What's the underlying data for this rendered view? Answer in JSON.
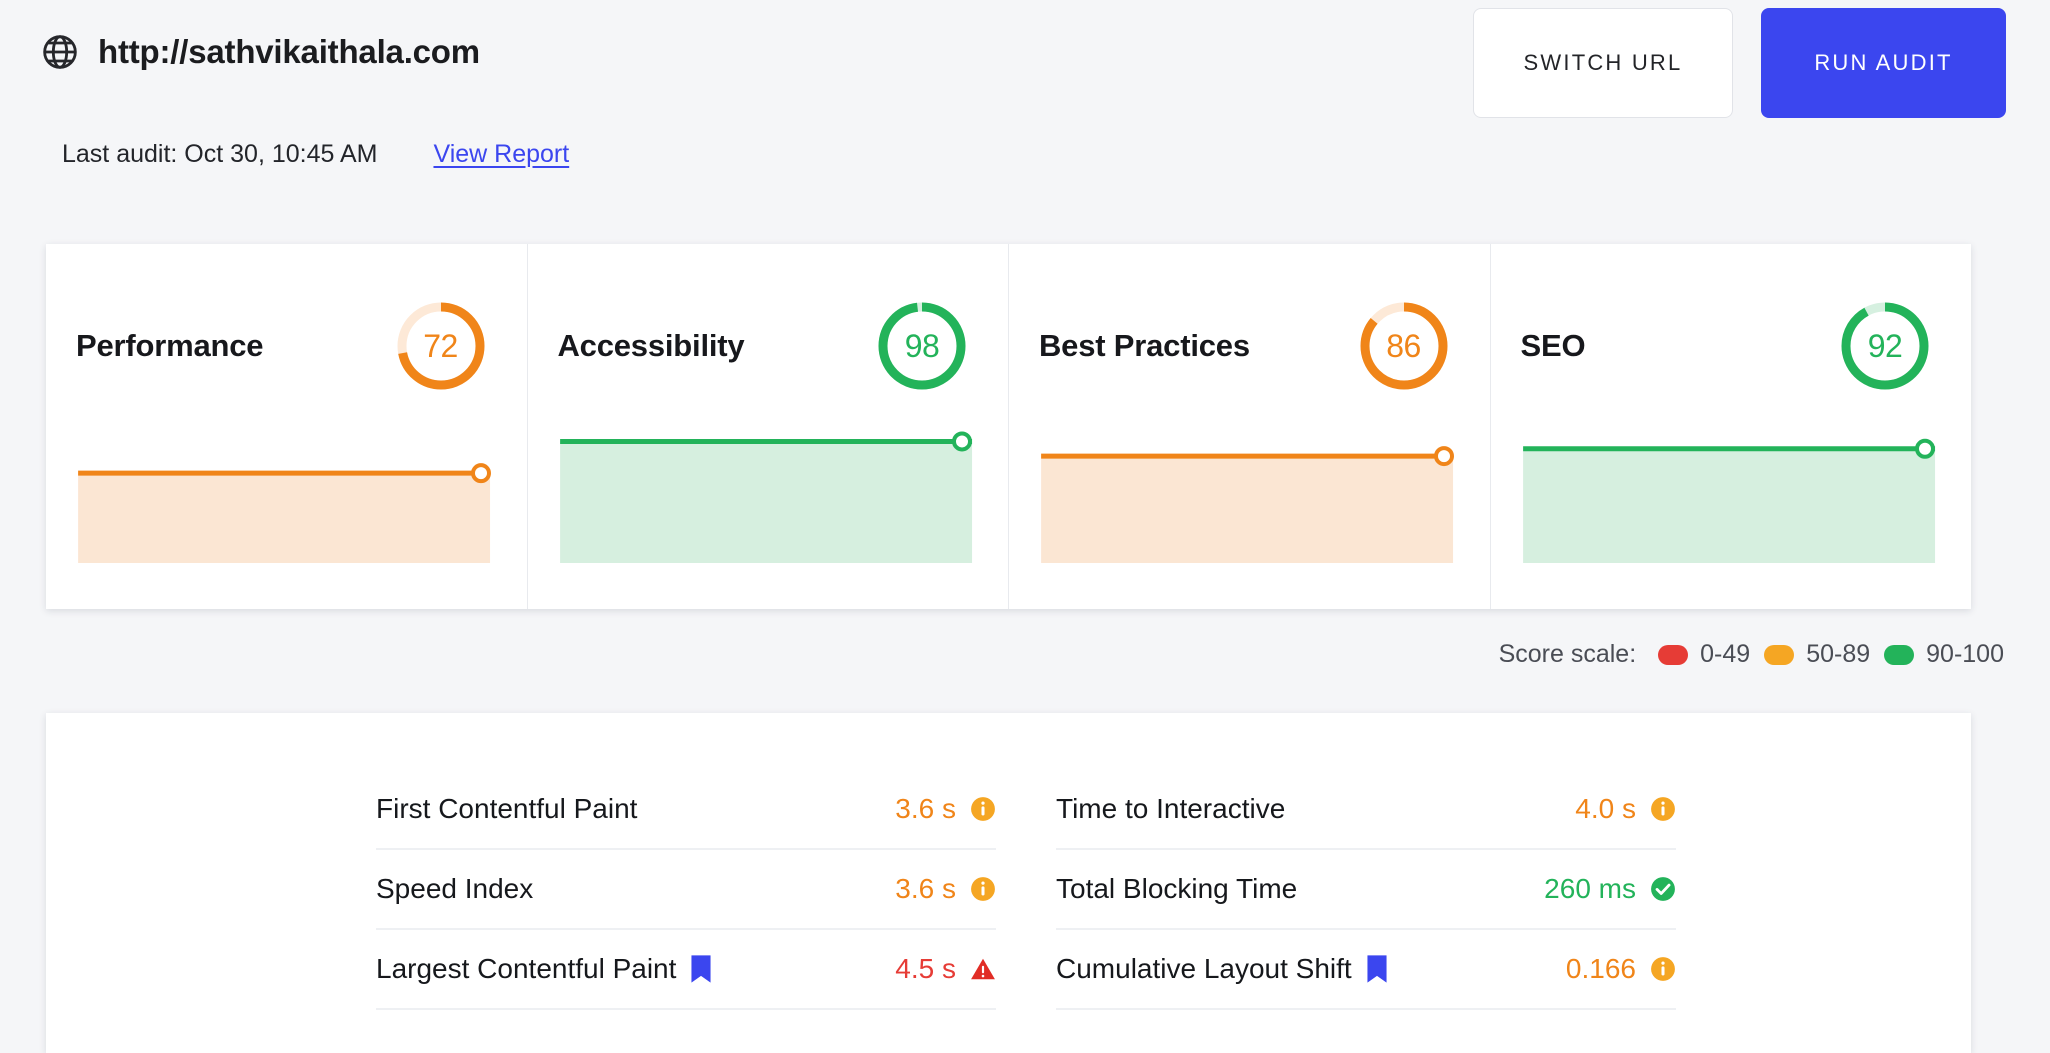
{
  "header": {
    "globe_icon": "globe-icon",
    "url": "http://sathvikaithala.com",
    "last_audit": "Last audit: Oct 30, 10:45 AM",
    "view_report": "View Report",
    "switch_url_label": "SWITCH URL",
    "run_audit_label": "RUN AUDIT"
  },
  "colors": {
    "orange": "#f08519",
    "orange_track": "#fde9d7",
    "orange_fill": "#fbe6d3",
    "green": "#23b35a",
    "green_track": "#d6f0e0",
    "green_fill": "#d6efdf",
    "red": "#e63c36",
    "blue": "#3b46ef",
    "background": "#f5f6f8"
  },
  "scores": [
    {
      "title": "Performance",
      "value": 72,
      "color": "#f08519",
      "track": "#fde9d7",
      "fill": "#fbe6d3"
    },
    {
      "title": "Accessibility",
      "value": 98,
      "color": "#23b35a",
      "track": "#d6f0e0",
      "fill": "#d6efdf"
    },
    {
      "title": "Best Practices",
      "value": 86,
      "color": "#f08519",
      "track": "#fde9d7",
      "fill": "#fbe6d3"
    },
    {
      "title": "SEO",
      "value": 92,
      "color": "#23b35a",
      "track": "#d6f0e0",
      "fill": "#d6efdf"
    }
  ],
  "legend": {
    "label": "Score scale:",
    "items": [
      {
        "range": "0-49",
        "color": "#e63c36"
      },
      {
        "range": "50-89",
        "color": "#f5a623"
      },
      {
        "range": "90-100",
        "color": "#23b35a"
      }
    ]
  },
  "metrics": {
    "left": [
      {
        "name": "First Contentful Paint",
        "flag": false,
        "value": "3.6 s",
        "value_color": "#f08519",
        "status": "info",
        "status_color": "#f5a623"
      },
      {
        "name": "Speed Index",
        "flag": false,
        "value": "3.6 s",
        "value_color": "#f08519",
        "status": "info",
        "status_color": "#f5a623"
      },
      {
        "name": "Largest Contentful Paint",
        "flag": true,
        "value": "4.5 s",
        "value_color": "#e63c36",
        "status": "warning",
        "status_color": "#e12d26"
      }
    ],
    "right": [
      {
        "name": "Time to Interactive",
        "flag": false,
        "value": "4.0 s",
        "value_color": "#f08519",
        "status": "info",
        "status_color": "#f5a623"
      },
      {
        "name": "Total Blocking Time",
        "flag": false,
        "value": "260 ms",
        "value_color": "#23b35a",
        "status": "check",
        "status_color": "#23b35a"
      },
      {
        "name": "Cumulative Layout Shift",
        "flag": true,
        "value": "0.166",
        "value_color": "#f08519",
        "status": "info",
        "status_color": "#f5a623"
      }
    ]
  },
  "chart_data": {
    "type": "area",
    "title": "Category score sparklines",
    "series": [
      {
        "name": "Performance",
        "value": 72,
        "color": "#f08519"
      },
      {
        "name": "Accessibility",
        "value": 98,
        "color": "#23b35a"
      },
      {
        "name": "Best Practices",
        "value": 86,
        "color": "#f08519"
      },
      {
        "name": "SEO",
        "value": 92,
        "color": "#23b35a"
      }
    ],
    "ylim": [
      0,
      100
    ],
    "grid": false,
    "legend_position": "below-right"
  }
}
